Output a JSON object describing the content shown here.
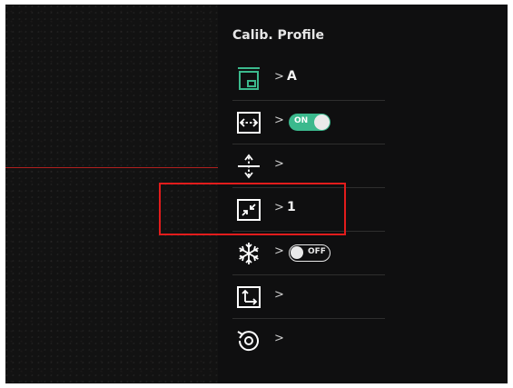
{
  "panel": {
    "title": "Calib. Profile",
    "items": [
      {
        "icon": "calibration-profile-icon",
        "value": "A"
      },
      {
        "icon": "horizontal-stretch-icon",
        "toggle": "ON"
      },
      {
        "icon": "vertical-adjust-icon"
      },
      {
        "icon": "zoom-compress-icon",
        "value": "1"
      },
      {
        "icon": "freeze-snowflake-icon",
        "toggle": "OFF"
      },
      {
        "icon": "axis-position-icon"
      },
      {
        "icon": "reset-rotate-icon"
      }
    ],
    "chevron": ">"
  },
  "colors": {
    "accent_green": "#3bb98d",
    "highlight_red": "#e21c1c",
    "crosshair_red": "#b0201f"
  }
}
